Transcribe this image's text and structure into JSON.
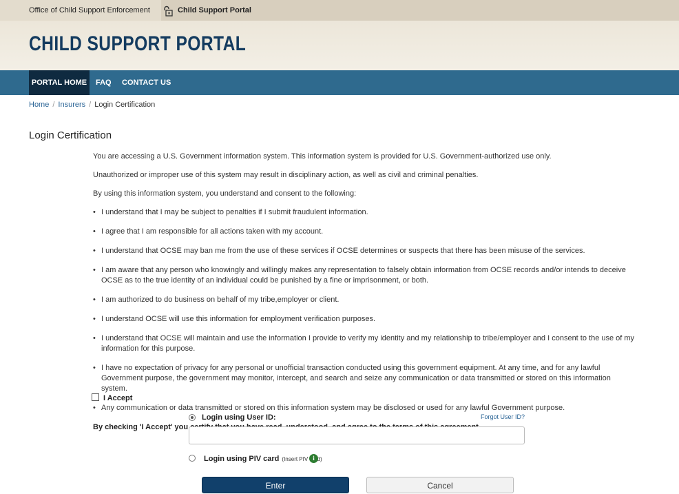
{
  "topbar": {
    "org": "Office of Child Support Enforcement",
    "portal": "Child Support Portal"
  },
  "banner": {
    "title": "CHILD SUPPORT PORTAL"
  },
  "nav": {
    "home": "PORTAL HOME",
    "faq": "FAQ",
    "contact": "CONTACT US"
  },
  "breadcrumb": {
    "home": "Home",
    "insurers": "Insurers",
    "current": "Login Certification",
    "sep": "/"
  },
  "page_title": "Login Certification",
  "intro": [
    "You are accessing a U.S. Government information system. This information system is provided for U.S. Government-authorized use only.",
    "Unauthorized or improper use of this system may result in disciplinary action, as well as civil and criminal penalties.",
    "By using this information system, you understand and consent to the following:"
  ],
  "terms": [
    "I understand that I may be subject to penalties if I submit fraudulent information.",
    "I agree that I am responsible for all actions taken with my account.",
    "I understand that OCSE may ban me from the use of these services if OCSE determines or suspects that there has been misuse of the services.",
    "I am aware that any person who knowingly and willingly makes any representation to falsely obtain information from OCSE records and/or intends to deceive OCSE as to the true identity of an individual could be punished by a fine or imprisonment, or both.",
    "I am authorized to do business on behalf of my tribe,employer or client.",
    "I understand OCSE will use this information for employment verification purposes.",
    "I understand that OCSE will maintain and use the information I provide to verify my identity and my relationship to tribe/employer and I consent to the use of my information for this purpose.",
    "I have no expectation of privacy for any personal or unofficial transaction conducted using this government equipment. At any time, and for any lawful Government purpose, the government may monitor, intercept, and search and seize any communication or data transmitted or stored on this information system.",
    "Any communication or data transmitted or stored on this information system may be disclosed or used for any lawful Government purpose."
  ],
  "agreement": "By checking 'I Accept' you certify that you have read, understood, and agree to the terms of this agreement.",
  "accept_label": "I Accept",
  "login": {
    "userid_label": "Login using User ID:",
    "forgot": "Forgot User ID?",
    "userid_value": "",
    "piv_label": "Login using PIV card",
    "piv_hint": "(Insert PIV card)",
    "info_icon": "i"
  },
  "buttons": {
    "enter": "Enter",
    "cancel": "Cancel"
  },
  "colors": {
    "nav": "#2f6a8e",
    "nav_active": "#0f2a40",
    "title": "#143b5f",
    "enter_btn": "#11406b",
    "info": "#2e7d32"
  }
}
